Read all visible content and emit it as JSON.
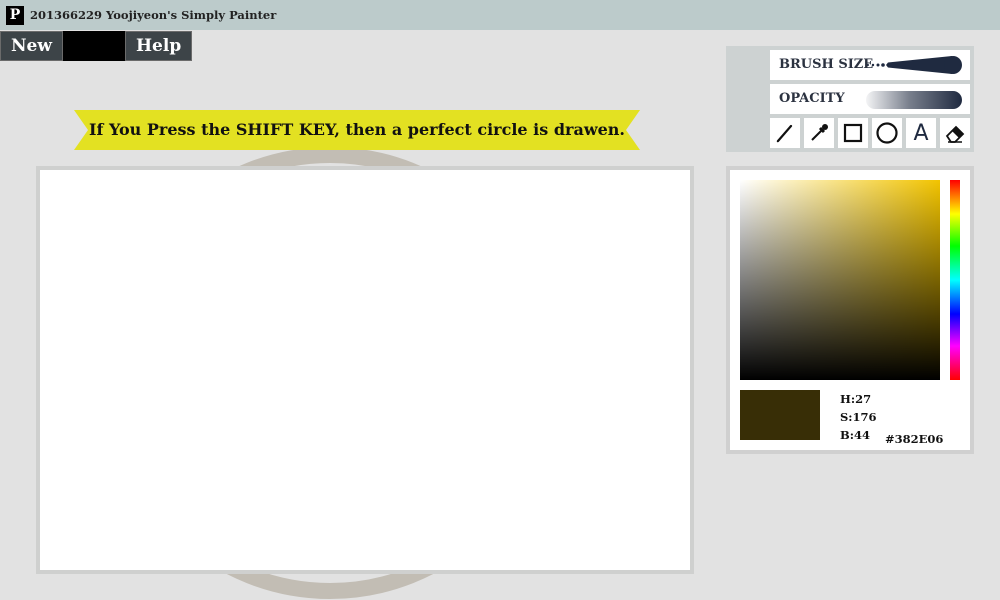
{
  "window": {
    "logo_letter": "P",
    "title": "201366229 Yoojiyeon's Simply Painter"
  },
  "menu": {
    "new_label": "New",
    "help_label": "Help"
  },
  "banner": {
    "text": "If You Press the SHIFT KEY, then a perfect circle is drawen.",
    "color": "#e3e122"
  },
  "brush": {
    "size_label": "BRUSH SIZE",
    "opacity_label": "OPACITY",
    "color": "#1f2a40"
  },
  "tools": [
    {
      "name": "pen-tool",
      "icon": "pen-icon"
    },
    {
      "name": "eyedropper-tool",
      "icon": "eyedropper-icon"
    },
    {
      "name": "rectangle-tool",
      "icon": "square-icon"
    },
    {
      "name": "circle-tool",
      "icon": "circle-icon"
    },
    {
      "name": "text-tool",
      "icon": "text-icon",
      "glyph": "A"
    },
    {
      "name": "eraser-tool",
      "icon": "eraser-icon"
    }
  ],
  "color_picker": {
    "base_hue_color": "#f2c400",
    "current_color": "#382E06",
    "h_label": "H:27",
    "s_label": "S:176",
    "b_label": "B:44",
    "hex_label": "#382E06"
  }
}
